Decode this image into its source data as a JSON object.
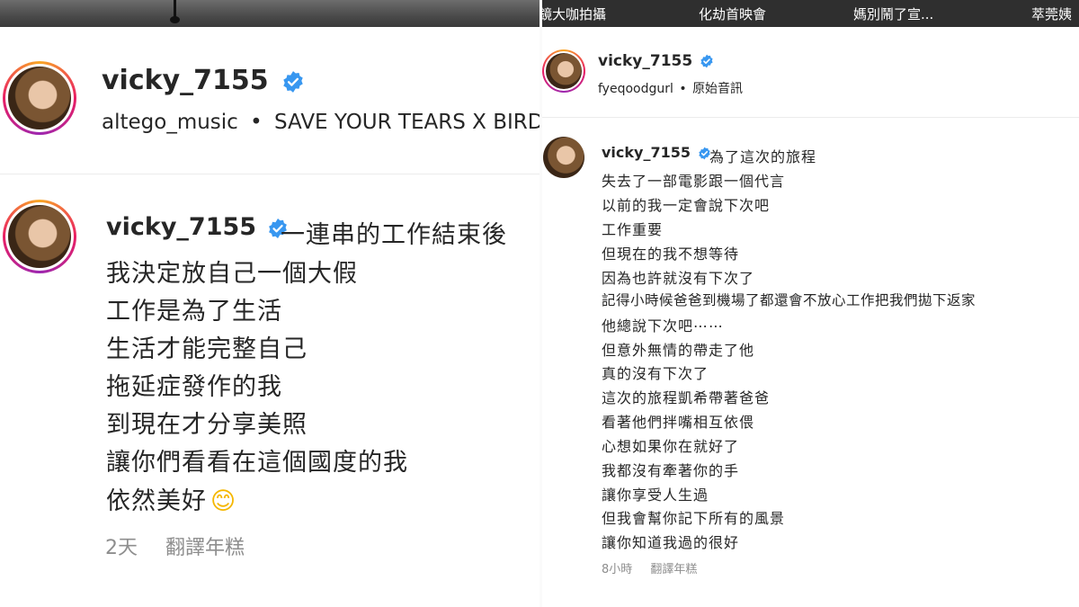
{
  "left": {
    "header": {
      "username": "vicky_7155",
      "audio_source": "altego_music",
      "separator": "•",
      "audio_title": "SAVE YOUR TEARS X BIRD"
    },
    "caption": {
      "username": "vicky_7155",
      "lines": [
        "一連串的工作結束後",
        "我決定放自己一個大假",
        "工作是為了生活",
        "生活才能完整自己",
        "拖延症發作的我",
        "到現在才分享美照",
        "讓你們看看在這個國度的我",
        "依然美好"
      ],
      "emoji": "😊",
      "time": "2天",
      "translate_label": "翻譯年糕"
    }
  },
  "right": {
    "top_strip": [
      "鏡大咖拍攝",
      "化劫首映會",
      "媽別鬧了宣...",
      "萃莞姨"
    ],
    "header": {
      "username": "vicky_7155",
      "audio_source": "fyeqoodgurl",
      "separator": "•",
      "audio_title": "原始音訊"
    },
    "caption": {
      "username": "vicky_7155",
      "lines": [
        "為了這次的旅程",
        "失去了一部電影跟一個代言",
        "以前的我一定會說下次吧",
        "工作重要",
        "但現在的我不想等待",
        "因為也許就沒有下次了",
        "記得小時候爸爸到機場了都還會不放心工作把我們拋下返家",
        "他總說下次吧⋯⋯",
        "但意外無情的帶走了他",
        "真的沒有下次了",
        "這次的旅程凱希帶著爸爸",
        "看著他們拌嘴相互依偎",
        "心想如果你在就好了",
        "我都沒有牽著你的手",
        "讓你享受人生過",
        "但我會幫你記下所有的風景",
        "讓你知道我過的很好"
      ],
      "time": "8小時",
      "translate_label": "翻譯年糕"
    }
  },
  "colors": {
    "verified": "#3897f0",
    "text": "#262626",
    "muted": "#8e8e8e"
  },
  "icons": [
    "verified-badge-icon",
    "smiling-face-emoji"
  ]
}
